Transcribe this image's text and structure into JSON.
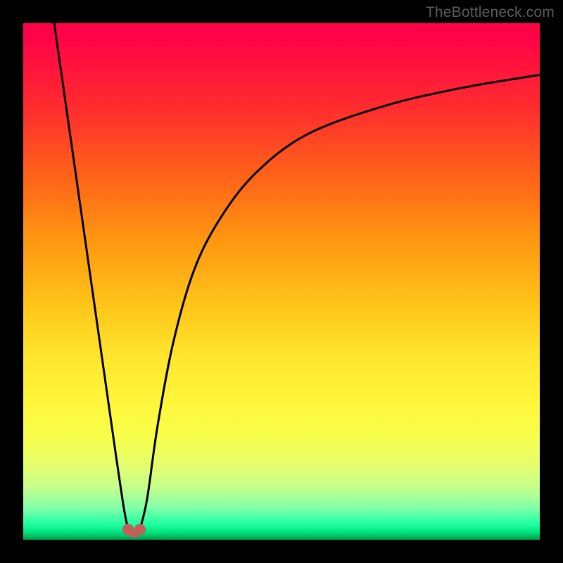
{
  "attribution": "TheBottleneck.com",
  "chart_data": {
    "type": "line",
    "title": "",
    "xlabel": "",
    "ylabel": "",
    "xlim": [
      0,
      100
    ],
    "ylim": [
      0,
      100
    ],
    "grid": false,
    "legend": false,
    "notes": "Bottleneck-style curve. No numeric axes are shown; values are inferred as percentages of plot width/height. Two branches meet at a minimum near x≈21.5; y rises steeply on both sides. Right branch plateaus near y≈90 at right edge.",
    "series": [
      {
        "name": "left-branch",
        "x": [
          6,
          8,
          10,
          12,
          14,
          16,
          18,
          19.5,
          20.3
        ],
        "y": [
          100,
          86,
          72,
          58,
          44,
          30,
          16,
          6,
          2
        ]
      },
      {
        "name": "right-branch",
        "x": [
          22.6,
          24,
          26,
          29,
          33,
          38,
          45,
          55,
          70,
          85,
          100
        ],
        "y": [
          2,
          8,
          22,
          38,
          52,
          62,
          71,
          78.5,
          84,
          87.5,
          90
        ]
      }
    ],
    "markers": [
      {
        "name": "min-left",
        "x": 20.3,
        "y": 2,
        "r_pct": 1.1,
        "color": "#c06058"
      },
      {
        "name": "min-right",
        "x": 22.6,
        "y": 2,
        "r_pct": 1.1,
        "color": "#c06058"
      }
    ],
    "connector": {
      "from": "min-left",
      "to": "min-right",
      "y": 1.2,
      "color": "#c06058"
    },
    "background_gradient": {
      "top": "#ff0346",
      "mid": "#ffe72e",
      "bottom": "#009a48"
    }
  }
}
